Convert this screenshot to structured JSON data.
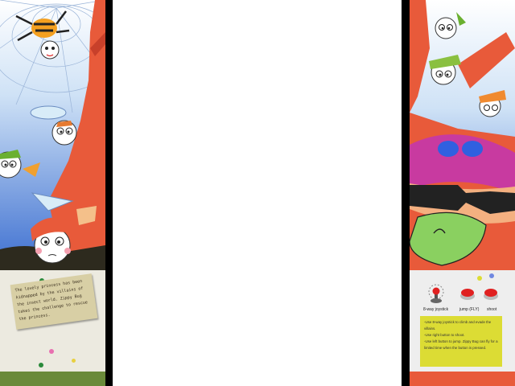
{
  "story": {
    "text": "The lovely princess has been kidnapped by the villains of the insect world. Zippy Bug takes the challenge to rescue the princess."
  },
  "controls": {
    "joystick_label": "8-way joystick",
    "jump_label": "jump (FLY)",
    "shoot_label": "shoot",
    "instructions": [
      "-Use 8-way joystick to climb and evade the villains.",
      "-Use right button to shoot.",
      "-Use left button to jump.  Zippy Bug can fly for a limited time when the button is pressed."
    ]
  },
  "colors": {
    "background": "#000000",
    "center": "#ffffff",
    "sky": "#5a8ad8",
    "tree": "#e85a3a",
    "button_red": "#e02020",
    "instructions_bg": "#dcdc34"
  }
}
